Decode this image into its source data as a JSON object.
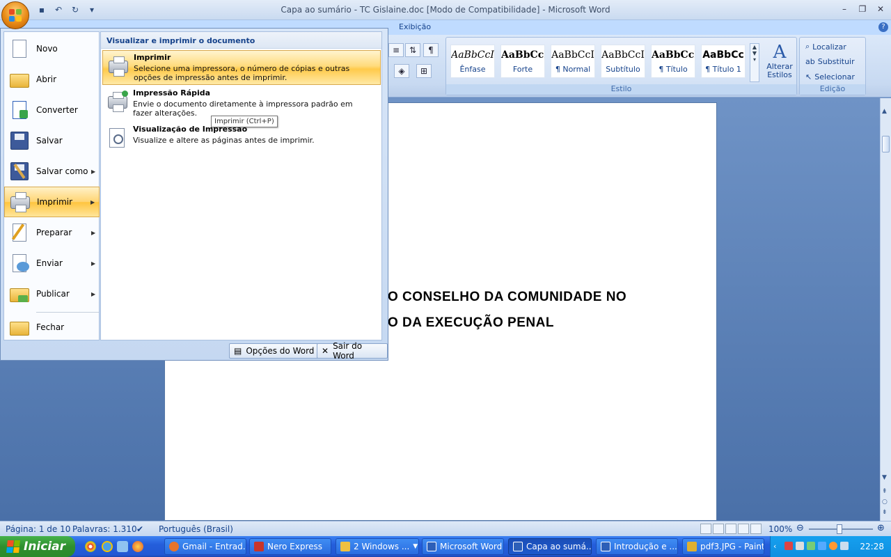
{
  "window": {
    "title": "Capa ao sumário - TC Gislaine.doc [Modo de Compatibilidade] - Microsoft Word"
  },
  "quick_access": {
    "icons": [
      "save-icon",
      "undo-icon",
      "redo-icon",
      "customize-icon"
    ]
  },
  "ribbon": {
    "visible_tab": "Exibição",
    "styles_group_label": "Estilo",
    "styles": [
      {
        "sample": "AaBbCcI",
        "name": "Ênfase"
      },
      {
        "sample": "AaBbCcI",
        "name": "Forte"
      },
      {
        "sample": "AaBbCcI",
        "name": "¶ Normal"
      },
      {
        "sample": "AaBbCcI",
        "name": "Subtítulo"
      },
      {
        "sample": "AaBbCcI",
        "name": "¶ Título"
      },
      {
        "sample": "AaBbCc",
        "name": "¶ Título 1"
      }
    ],
    "change_styles_label": "Alterar Estilos",
    "editing_group_label": "Edição",
    "editing_items": [
      "Localizar",
      "Substituir",
      "Selecionar"
    ]
  },
  "office_menu": {
    "left_items": [
      {
        "label": "Novo",
        "icon": "new-document-icon",
        "submenu": false
      },
      {
        "label": "Abrir",
        "icon": "open-folder-icon",
        "submenu": false
      },
      {
        "label": "Converter",
        "icon": "convert-icon",
        "submenu": false
      },
      {
        "label": "Salvar",
        "icon": "save-disk-icon",
        "submenu": false
      },
      {
        "label": "Salvar como",
        "icon": "save-as-icon",
        "submenu": true
      },
      {
        "label": "Imprimir",
        "icon": "printer-icon",
        "submenu": true,
        "selected": true
      },
      {
        "label": "Preparar",
        "icon": "prepare-icon",
        "submenu": true
      },
      {
        "label": "Enviar",
        "icon": "send-icon",
        "submenu": true
      },
      {
        "label": "Publicar",
        "icon": "publish-icon",
        "submenu": true
      },
      {
        "label": "Fechar",
        "icon": "close-folder-icon",
        "submenu": false
      }
    ],
    "right_header": "Visualizar e imprimir o documento",
    "right_items": [
      {
        "title": "Imprimir",
        "desc": "Selecione uma impressora, o número de cópias e outras opções de impressão antes de imprimir.",
        "icon": "printer-icon"
      },
      {
        "title": "Impressão Rápida",
        "desc": "Envie o documento diretamente à impressora padrão em fazer alterações.",
        "icon": "quick-print-icon"
      },
      {
        "title": "Visualização de Impressão",
        "desc": "Visualize e altere as páginas antes de imprimir.",
        "icon": "print-preview-icon"
      }
    ],
    "tooltip": "Imprimir (Ctrl+P)",
    "footer": {
      "options_label": "Opções do Word",
      "exit_label": "Sair do Word"
    }
  },
  "document": {
    "line1": "O CONSELHO  DA COMUNIDADE  NO",
    "line2": "O DA EXECUÇÃO  PENAL"
  },
  "statusbar": {
    "page": "Página: 1 de 10",
    "words": "Palavras: 1.310",
    "language": "Português (Brasil)",
    "zoom": "100%"
  },
  "taskbar": {
    "start_label": "Iniciar",
    "buttons": [
      {
        "label": "Gmail - Entrad...",
        "color": "#e8742b"
      },
      {
        "label": "Nero Express",
        "color": "#c8352b"
      },
      {
        "label": "2 Windows ...",
        "color": "#f0c040"
      },
      {
        "label": "Microsoft Word",
        "color": "#2d5fb8"
      },
      {
        "label": "Capa ao sumá...",
        "color": "#2d5fb8",
        "active": true
      },
      {
        "label": "Introdução e ...",
        "color": "#2d5fb8"
      },
      {
        "label": "pdf3.JPG - Paint",
        "color": "#e0b030"
      }
    ],
    "clock": "22:28"
  }
}
